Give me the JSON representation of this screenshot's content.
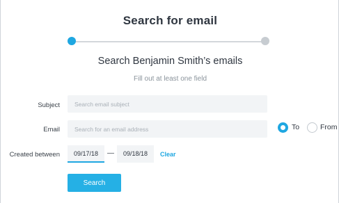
{
  "dialog": {
    "title": "Search for email",
    "subtitle": "Search Benjamin Smith’s emails",
    "hint": "Fill out at least one field"
  },
  "stepper": {
    "current_step": 1,
    "total_steps": 2,
    "active_color": "#1fa7e1",
    "inactive_color": "#c7ccd1"
  },
  "form": {
    "subject": {
      "label": "Subject",
      "placeholder": "Search email subject",
      "value": ""
    },
    "email": {
      "label": "Email",
      "placeholder": "Search for an email address",
      "value": ""
    },
    "direction": {
      "options": [
        "To",
        "From"
      ],
      "selected": "To"
    },
    "created_between": {
      "label": "Created between",
      "from": "09/17/18",
      "separator": "—",
      "to": "09/18/18",
      "clear_label": "Clear"
    },
    "submit_label": "Search"
  },
  "colors": {
    "accent": "#1fa7e1",
    "field_bg": "#f2f4f6"
  }
}
